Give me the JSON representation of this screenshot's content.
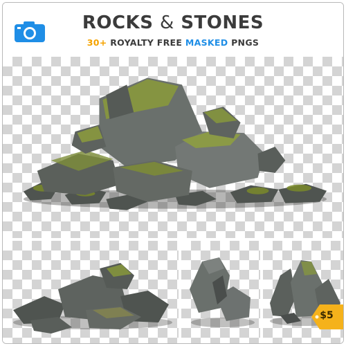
{
  "header": {
    "title_left": "ROCKS",
    "title_amp": "&",
    "title_right": "STONES",
    "subtitle_count": "30+",
    "subtitle_mid": "ROYALTY FREE",
    "subtitle_masked": "MASKED",
    "subtitle_end": "PNGS"
  },
  "icons": {
    "camera": "camera-icon",
    "price_tag": "price-tag-icon"
  },
  "price": "$5",
  "colors": {
    "camera_blue": "#1f8ee6",
    "count_orange": "#f5a300",
    "masked_blue": "#1f8ee6",
    "price_gold": "#f5b21b"
  }
}
